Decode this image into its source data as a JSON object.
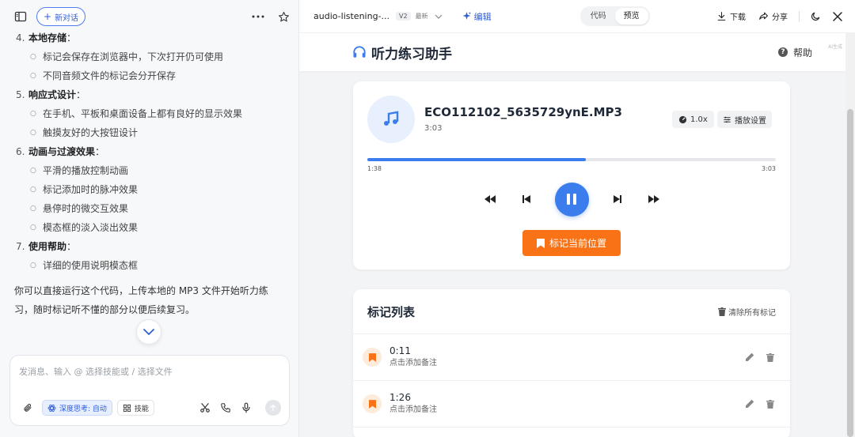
{
  "left_panel": {
    "new_chat_label": "新对话",
    "list": [
      {
        "num": "4.",
        "title": "本地存储",
        "items": [
          "标记会保存在浏览器中，下次打开仍可使用",
          "不同音频文件的标记会分开保存"
        ]
      },
      {
        "num": "5.",
        "title": "响应式设计",
        "items": [
          "在手机、平板和桌面设备上都有良好的显示效果",
          "触摸友好的大按钮设计"
        ]
      },
      {
        "num": "6.",
        "title": "动画与过渡效果",
        "items": [
          "平滑的播放控制动画",
          "标记添加时的脉冲效果",
          "悬停时的微交互效果",
          "模态框的淡入淡出效果"
        ]
      },
      {
        "num": "7.",
        "title": "使用帮助",
        "items": [
          "详细的使用说明模态框"
        ]
      }
    ],
    "paragraph": "你可以直接运行这个代码，上传本地的 MP3 文件开始听力练习，随时标记听不懂的部分以便后续复习。"
  },
  "composer": {
    "placeholder": "发消息、输入 @ 选择技能或 / 选择文件",
    "deep_think_label": "深度思考: 自动",
    "skill_label": "技能"
  },
  "topbar": {
    "file_name": "audio-listening-...",
    "version": "V2",
    "latest": "最新",
    "edit_label": "编辑",
    "tab_code": "代码",
    "tab_preview": "预览",
    "download_label": "下载",
    "share_label": "分享"
  },
  "app": {
    "title": "听力练习助手",
    "help_label": "帮助",
    "ai_tag": "AI生成",
    "track_name": "ECO112102_5635729ynE.MP3",
    "track_duration": "3:03",
    "speed_label": "1.0x",
    "settings_label": "播放设置",
    "current_time": "1:38",
    "total_time": "3:03",
    "progress_fraction": 0.535,
    "mark_button_label": "标记当前位置",
    "marks_title": "标记列表",
    "clear_all_label": "清除所有标记",
    "marks": [
      {
        "time": "0:11",
        "note": "点击添加备注"
      },
      {
        "time": "1:26",
        "note": "点击添加备注"
      }
    ]
  },
  "colors": {
    "accent_blue": "#3b7ded",
    "accent_orange": "#f97316",
    "link_blue": "#2f5ed8"
  }
}
